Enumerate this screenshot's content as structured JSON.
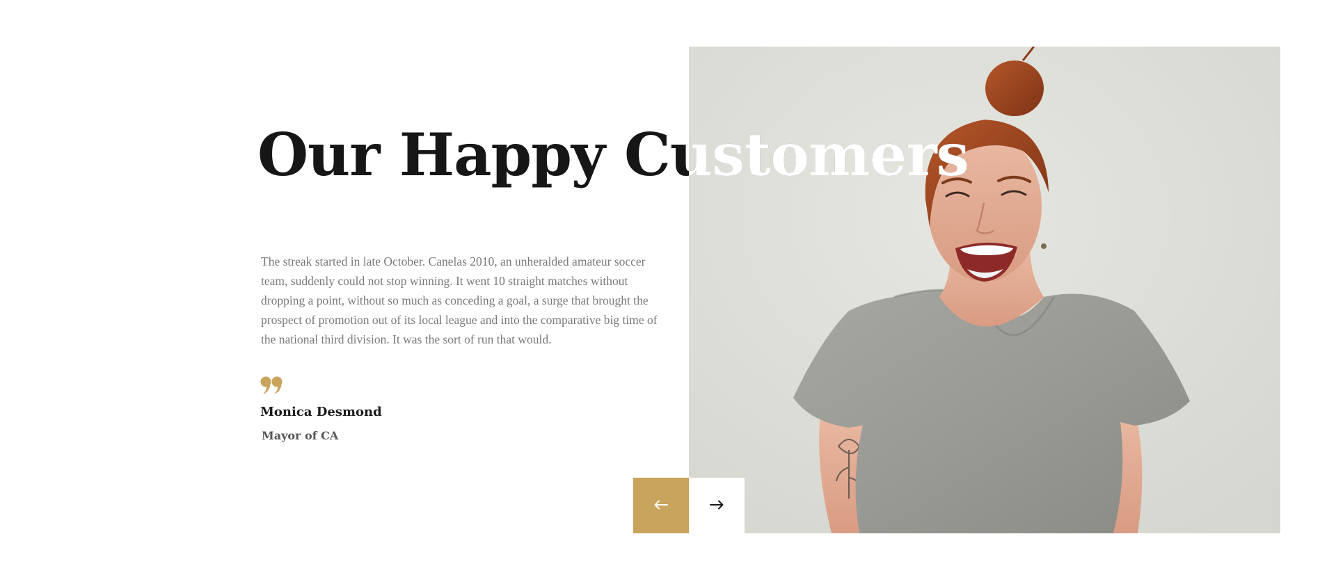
{
  "section": {
    "title": "Our Happy Customers"
  },
  "testimonial": {
    "text": "The streak started in late October. Canelas 2010, an unheralded amateur soccer team, suddenly could not stop winning. It went 10 straight matches without dropping a point, without so much as conceding a goal, a surge that brought the prospect of promotion out of its local league and into the comparative big time of the national third division. It was the sort of run that would.",
    "author_name": "Monica Desmond",
    "author_role": "Mayor of CA",
    "quote_icon": "quote-icon"
  },
  "navigation": {
    "prev_icon": "arrow-left-icon",
    "next_icon": "arrow-right-icon"
  },
  "colors": {
    "accent": "#c9a45c",
    "heading": "#161616",
    "body_text": "#7a7a7a",
    "background": "#ffffff"
  }
}
